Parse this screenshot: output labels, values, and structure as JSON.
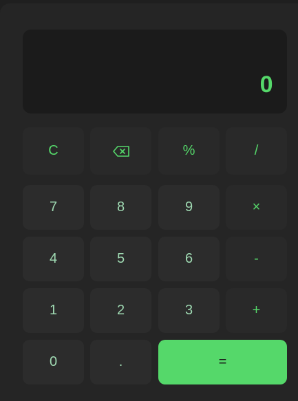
{
  "display": {
    "value": "0"
  },
  "keys": {
    "clear": "C",
    "backspace": "⌫",
    "percent": "%",
    "divide": "/",
    "seven": "7",
    "eight": "8",
    "nine": "9",
    "multiply": "×",
    "four": "4",
    "five": "5",
    "six": "6",
    "subtract": "-",
    "one": "1",
    "two": "2",
    "three": "3",
    "add": "+",
    "zero": "0",
    "decimal": ".",
    "equals": "="
  },
  "colors": {
    "accent": "#55d86a",
    "background": "#252525",
    "display_bg": "#1b1b1b",
    "key_bg": "#2c2c2c",
    "digit_text": "#9fd9b2"
  },
  "icons": {
    "backspace": "backspace-icon"
  }
}
